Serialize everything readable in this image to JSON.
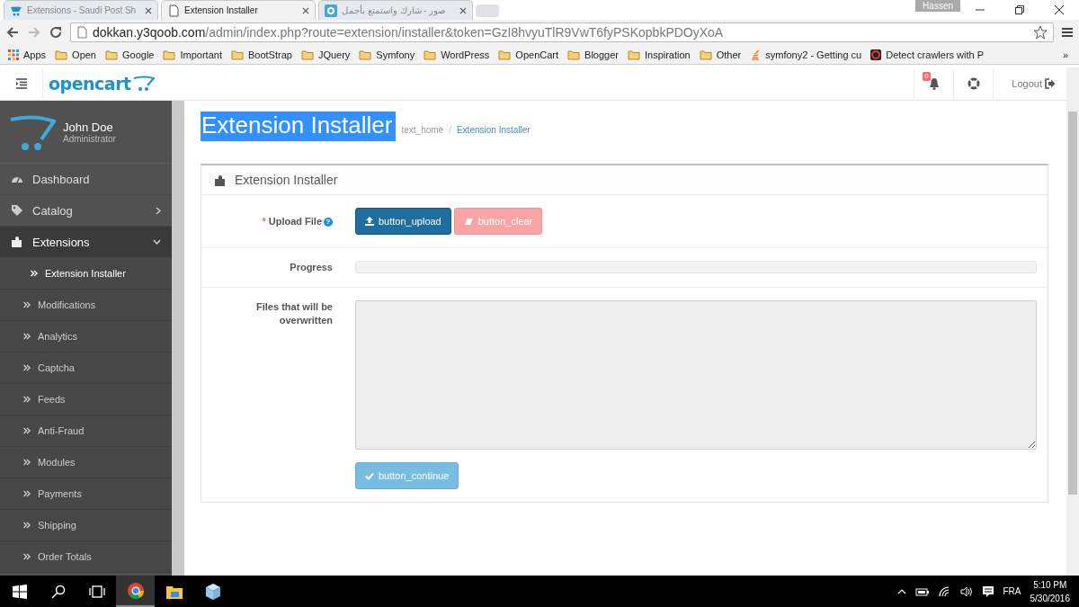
{
  "browser": {
    "tabs": [
      {
        "title": "Extensions - Saudi Post Sh",
        "selected": false,
        "kind": "cart"
      },
      {
        "title": "Extension Installer",
        "selected": true,
        "kind": "page"
      },
      {
        "title": "صور - شارك واستمتع بأجمل",
        "selected": false,
        "kind": "camera"
      }
    ],
    "profile": "Hassen",
    "address": {
      "host": "dokkan.y3qoob.com",
      "path": "/admin/index.php?route=extension/installer&token=GzI8hvyuTlR9VwT6fyPSKopbkPDOyXoA"
    },
    "bookmarks": [
      {
        "label": "Apps",
        "kind": "apps"
      },
      {
        "label": "Open",
        "kind": "folder"
      },
      {
        "label": "Google",
        "kind": "folder"
      },
      {
        "label": "Important",
        "kind": "folder"
      },
      {
        "label": "BootStrap",
        "kind": "folder"
      },
      {
        "label": "JQuery",
        "kind": "folder"
      },
      {
        "label": "Symfony",
        "kind": "folder"
      },
      {
        "label": "WordPress",
        "kind": "folder"
      },
      {
        "label": "OpenCart",
        "kind": "folder"
      },
      {
        "label": "Blogger",
        "kind": "folder"
      },
      {
        "label": "Inspiration",
        "kind": "folder"
      },
      {
        "label": "Other",
        "kind": "folder"
      },
      {
        "label": "symfony2 - Getting cu",
        "kind": "stack"
      },
      {
        "label": "Detect crawlers with P",
        "kind": "site"
      }
    ],
    "more": "»"
  },
  "header": {
    "logo": "opencart",
    "notifications": "0",
    "logout": "Logout"
  },
  "sidebar": {
    "user": {
      "name": "John Doe",
      "role": "Administrator"
    },
    "menu": [
      {
        "label": "Dashboard",
        "kind": "dashboard",
        "selected": false
      },
      {
        "label": "Catalog",
        "kind": "catalog",
        "selected": false,
        "expanded": false
      },
      {
        "label": "Extensions",
        "kind": "extensions",
        "selected": true,
        "expanded": true,
        "children": [
          {
            "label": "Extension Installer",
            "selected": true
          },
          {
            "label": "Modifications",
            "selected": false
          },
          {
            "label": "Analytics",
            "selected": false
          },
          {
            "label": "Captcha",
            "selected": false
          },
          {
            "label": "Feeds",
            "selected": false
          },
          {
            "label": "Anti-Fraud",
            "selected": false
          },
          {
            "label": "Modules",
            "selected": false
          },
          {
            "label": "Payments",
            "selected": false
          },
          {
            "label": "Shipping",
            "selected": false
          },
          {
            "label": "Order Totals",
            "selected": false
          }
        ]
      }
    ]
  },
  "page": {
    "title": "Extension Installer",
    "title_selected": true,
    "breadcrumb": [
      "text_home",
      "Extension Installer"
    ],
    "breadcrumb_separator": "/",
    "panel": {
      "title": "Extension Installer",
      "upload": {
        "label": "Upload File",
        "required_mark": "*",
        "help": "?",
        "buttons": [
          {
            "label": "button_upload",
            "kind": "upload",
            "disabled": false
          },
          {
            "label": "button_clear",
            "kind": "clear",
            "disabled": true
          }
        ]
      },
      "progress": {
        "label": "Progress",
        "level": 0
      },
      "files": {
        "label": "Files that will be overwritten"
      },
      "continue": {
        "label": "button_continue",
        "disabled": true
      }
    }
  },
  "taskbar": {
    "language": "FRA",
    "time": "5:10 PM",
    "date": "5/30/2016"
  }
}
